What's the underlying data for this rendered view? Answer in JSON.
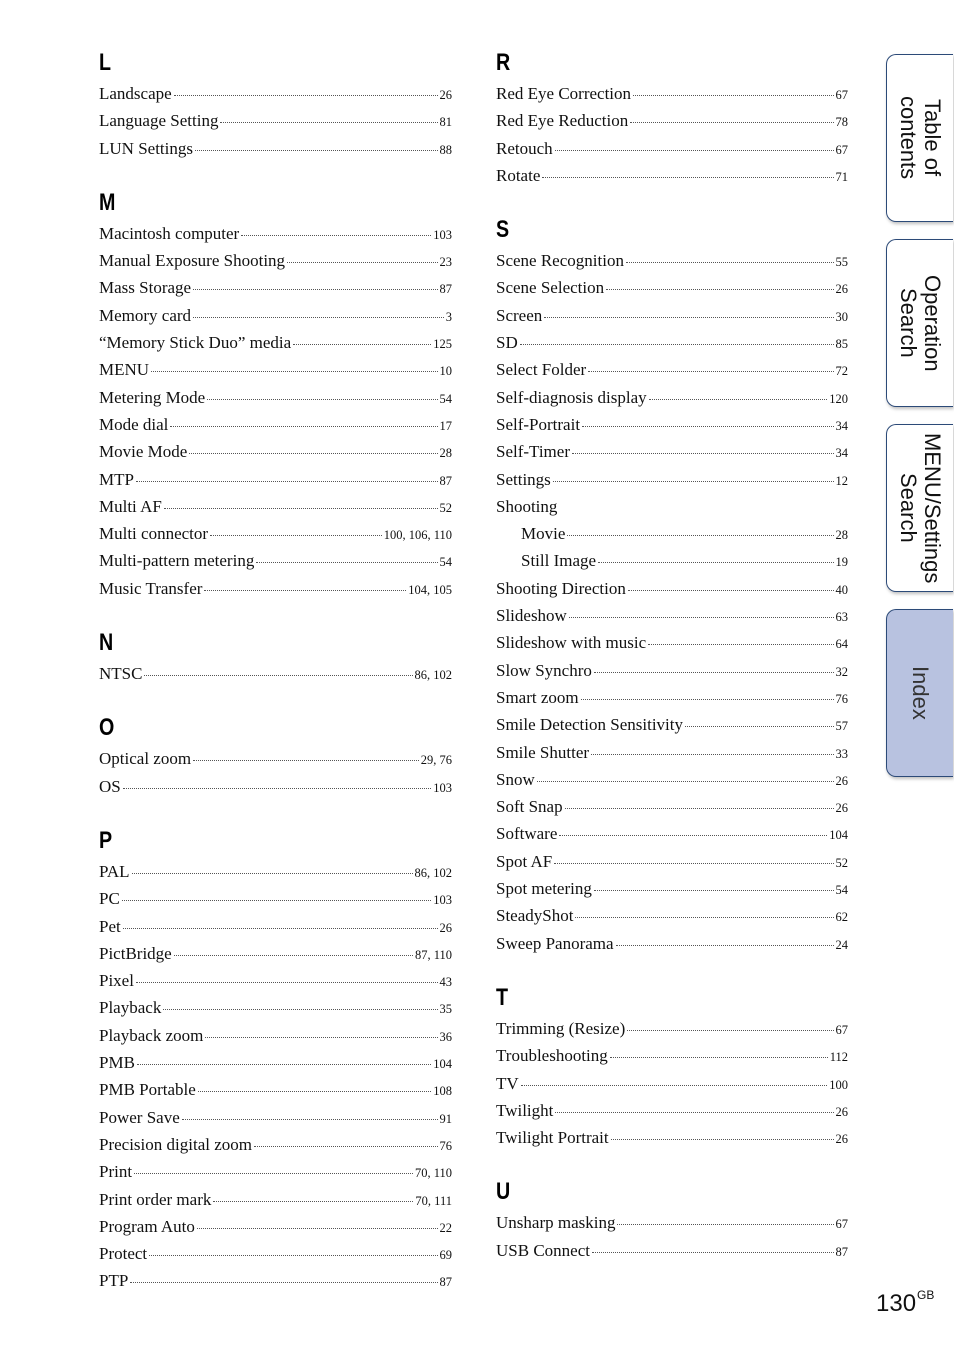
{
  "page": {
    "number": "130",
    "suffix": "GB"
  },
  "tabs": [
    {
      "label": "Table of\ncontents",
      "active": false
    },
    {
      "label": "Operation\nSearch",
      "active": false
    },
    {
      "label": "MENU/Settings\nSearch",
      "active": false
    },
    {
      "label": "Index",
      "active": true
    }
  ],
  "colors": {
    "tab_border": "#2c4a78",
    "tab_active_bg": "#b8c2e0",
    "tab_bg": "#ffffff"
  },
  "left_column": [
    {
      "letter": "L",
      "entries": [
        {
          "term": "Landscape",
          "pages": "26"
        },
        {
          "term": "Language Setting",
          "pages": "81"
        },
        {
          "term": "LUN Settings",
          "pages": "88"
        }
      ]
    },
    {
      "letter": "M",
      "entries": [
        {
          "term": "Macintosh computer",
          "pages": "103"
        },
        {
          "term": "Manual Exposure Shooting",
          "pages": "23"
        },
        {
          "term": "Mass Storage",
          "pages": "87"
        },
        {
          "term": "Memory card",
          "pages": "3"
        },
        {
          "term": "“Memory Stick Duo” media",
          "pages": "125"
        },
        {
          "term": "MENU",
          "pages": "10"
        },
        {
          "term": "Metering Mode",
          "pages": "54"
        },
        {
          "term": "Mode dial",
          "pages": "17"
        },
        {
          "term": "Movie Mode",
          "pages": "28"
        },
        {
          "term": "MTP",
          "pages": "87"
        },
        {
          "term": "Multi AF",
          "pages": "52"
        },
        {
          "term": "Multi connector",
          "pages": "100, 106, 110"
        },
        {
          "term": "Multi-pattern metering",
          "pages": "54"
        },
        {
          "term": "Music Transfer",
          "pages": "104, 105"
        }
      ]
    },
    {
      "letter": "N",
      "entries": [
        {
          "term": "NTSC",
          "pages": "86, 102"
        }
      ]
    },
    {
      "letter": "O",
      "entries": [
        {
          "term": "Optical zoom",
          "pages": "29, 76"
        },
        {
          "term": "OS",
          "pages": "103"
        }
      ]
    },
    {
      "letter": "P",
      "entries": [
        {
          "term": "PAL",
          "pages": "86, 102"
        },
        {
          "term": "PC",
          "pages": "103"
        },
        {
          "term": "Pet",
          "pages": "26"
        },
        {
          "term": "PictBridge",
          "pages": "87, 110"
        },
        {
          "term": "Pixel",
          "pages": "43"
        },
        {
          "term": "Playback",
          "pages": "35"
        },
        {
          "term": "Playback zoom",
          "pages": "36"
        },
        {
          "term": "PMB",
          "pages": "104"
        },
        {
          "term": "PMB Portable",
          "pages": "108"
        },
        {
          "term": "Power Save",
          "pages": "91"
        },
        {
          "term": "Precision digital zoom",
          "pages": "76"
        },
        {
          "term": "Print",
          "pages": "70, 110"
        },
        {
          "term": "Print order mark",
          "pages": "70, 111"
        },
        {
          "term": "Program Auto",
          "pages": "22"
        },
        {
          "term": "Protect",
          "pages": "69"
        },
        {
          "term": "PTP",
          "pages": "87"
        }
      ]
    }
  ],
  "right_column": [
    {
      "letter": "R",
      "entries": [
        {
          "term": "Red Eye Correction",
          "pages": "67"
        },
        {
          "term": "Red Eye Reduction",
          "pages": "78"
        },
        {
          "term": "Retouch",
          "pages": "67"
        },
        {
          "term": "Rotate",
          "pages": "71"
        }
      ]
    },
    {
      "letter": "S",
      "entries": [
        {
          "term": "Scene Recognition",
          "pages": "55"
        },
        {
          "term": "Scene Selection",
          "pages": "26"
        },
        {
          "term": "Screen",
          "pages": "30"
        },
        {
          "term": "SD",
          "pages": "85"
        },
        {
          "term": "Select Folder",
          "pages": "72"
        },
        {
          "term": "Self-diagnosis display",
          "pages": "120"
        },
        {
          "term": "Self-Portrait",
          "pages": "34"
        },
        {
          "term": "Self-Timer",
          "pages": "34"
        },
        {
          "term": "Settings",
          "pages": "12"
        },
        {
          "term": "Shooting",
          "pages": ""
        },
        {
          "term": "Movie",
          "pages": "28",
          "sub": true
        },
        {
          "term": "Still Image",
          "pages": "19",
          "sub": true
        },
        {
          "term": "Shooting Direction",
          "pages": "40"
        },
        {
          "term": "Slideshow",
          "pages": "63"
        },
        {
          "term": "Slideshow with music",
          "pages": "64"
        },
        {
          "term": "Slow Synchro",
          "pages": "32"
        },
        {
          "term": "Smart zoom",
          "pages": "76"
        },
        {
          "term": "Smile Detection Sensitivity",
          "pages": "57"
        },
        {
          "term": "Smile Shutter",
          "pages": "33"
        },
        {
          "term": "Snow",
          "pages": "26"
        },
        {
          "term": "Soft Snap",
          "pages": "26"
        },
        {
          "term": "Software",
          "pages": "104"
        },
        {
          "term": "Spot AF",
          "pages": "52"
        },
        {
          "term": "Spot metering",
          "pages": "54"
        },
        {
          "term": "SteadyShot",
          "pages": "62"
        },
        {
          "term": "Sweep Panorama",
          "pages": "24"
        }
      ]
    },
    {
      "letter": "T",
      "entries": [
        {
          "term": "Trimming (Resize)",
          "pages": "67"
        },
        {
          "term": "Troubleshooting",
          "pages": "112"
        },
        {
          "term": "TV",
          "pages": "100"
        },
        {
          "term": "Twilight",
          "pages": "26"
        },
        {
          "term": "Twilight Portrait",
          "pages": "26"
        }
      ]
    },
    {
      "letter": "U",
      "entries": [
        {
          "term": "Unsharp masking",
          "pages": "67"
        },
        {
          "term": "USB Connect",
          "pages": "87"
        }
      ]
    }
  ]
}
